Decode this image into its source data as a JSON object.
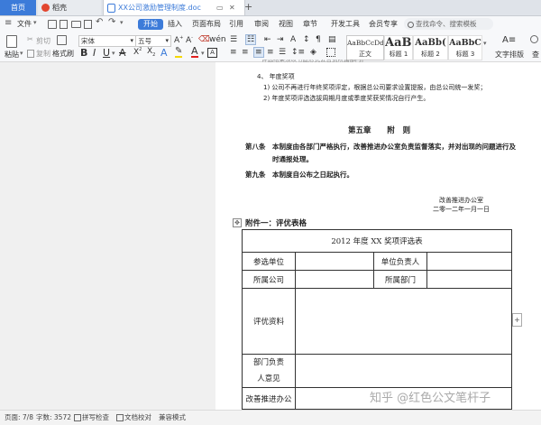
{
  "tabs": {
    "home": "首页",
    "daoke": "稻壳",
    "document": "XX公司激励管理制度.doc"
  },
  "menubar": {
    "file": "文件",
    "items": [
      "开始",
      "插入",
      "页面布局",
      "引用",
      "审阅",
      "视图",
      "章节",
      "开发工具",
      "会员专享"
    ],
    "search_placeholder": "查找命令、搜索模板"
  },
  "toolbar": {
    "paste": "粘贴",
    "cut": "剪切",
    "copy": "复制",
    "format_painter": "格式刷",
    "font_name": "宋体",
    "font_size": "五号",
    "styles": [
      {
        "preview": "AaBbCcDd",
        "label": "正文"
      },
      {
        "preview": "AaBl",
        "label": "标题 1"
      },
      {
        "preview": "AaBb(",
        "label": "标题 2"
      },
      {
        "preview": "AaBbC",
        "label": "标题 3"
      }
    ],
    "text_layout": "文字排版",
    "find": "查"
  },
  "document": {
    "line_top": "评选结果须以书面形式公告到所属部门。",
    "item4": "4、 年度奖项",
    "item4_1": "1)   公司不再进行年终奖项评定，根据总公司要求设置提报，由总公司统一发奖；",
    "item4_2": "2)   年度奖项评选选拔周期月度或季度奖获奖情况自行产生。",
    "chapter": "第五章      附   则",
    "article8_head": "第八条",
    "article8_text": "本制度由各部门严格执行，改善推进办公室负责监督落实，并对出现的问题进行及",
    "article8_text2": "时通报处理。",
    "article9_head": "第九条",
    "article9_text": "本制度自公布之日起执行。",
    "issuer": "改善推进办公室",
    "date": "二零一二年一月一日",
    "annex": "附件一：评优表格",
    "table": {
      "title": "2012 年度 XX 奖项评选表",
      "participant": "参选单位",
      "unit_head": "单位负责人",
      "company": "所属公司",
      "department": "所属部门",
      "evaluation": "评优资料",
      "dept_opinion_1": "部门负责",
      "dept_opinion_2": "人意见",
      "office_1": "改善推进办公"
    }
  },
  "statusbar": {
    "page": "页面: 7/8",
    "words": "字数: 3572",
    "spell": "拼写检查",
    "proof": "文档校对",
    "compat": "兼容模式"
  },
  "watermark": "知乎 @红色公文笔杆子",
  "colors": {
    "accent": "#3c7bd9",
    "daoke_icon": "#e2462f",
    "doc_icon": "#3c7bd9"
  }
}
